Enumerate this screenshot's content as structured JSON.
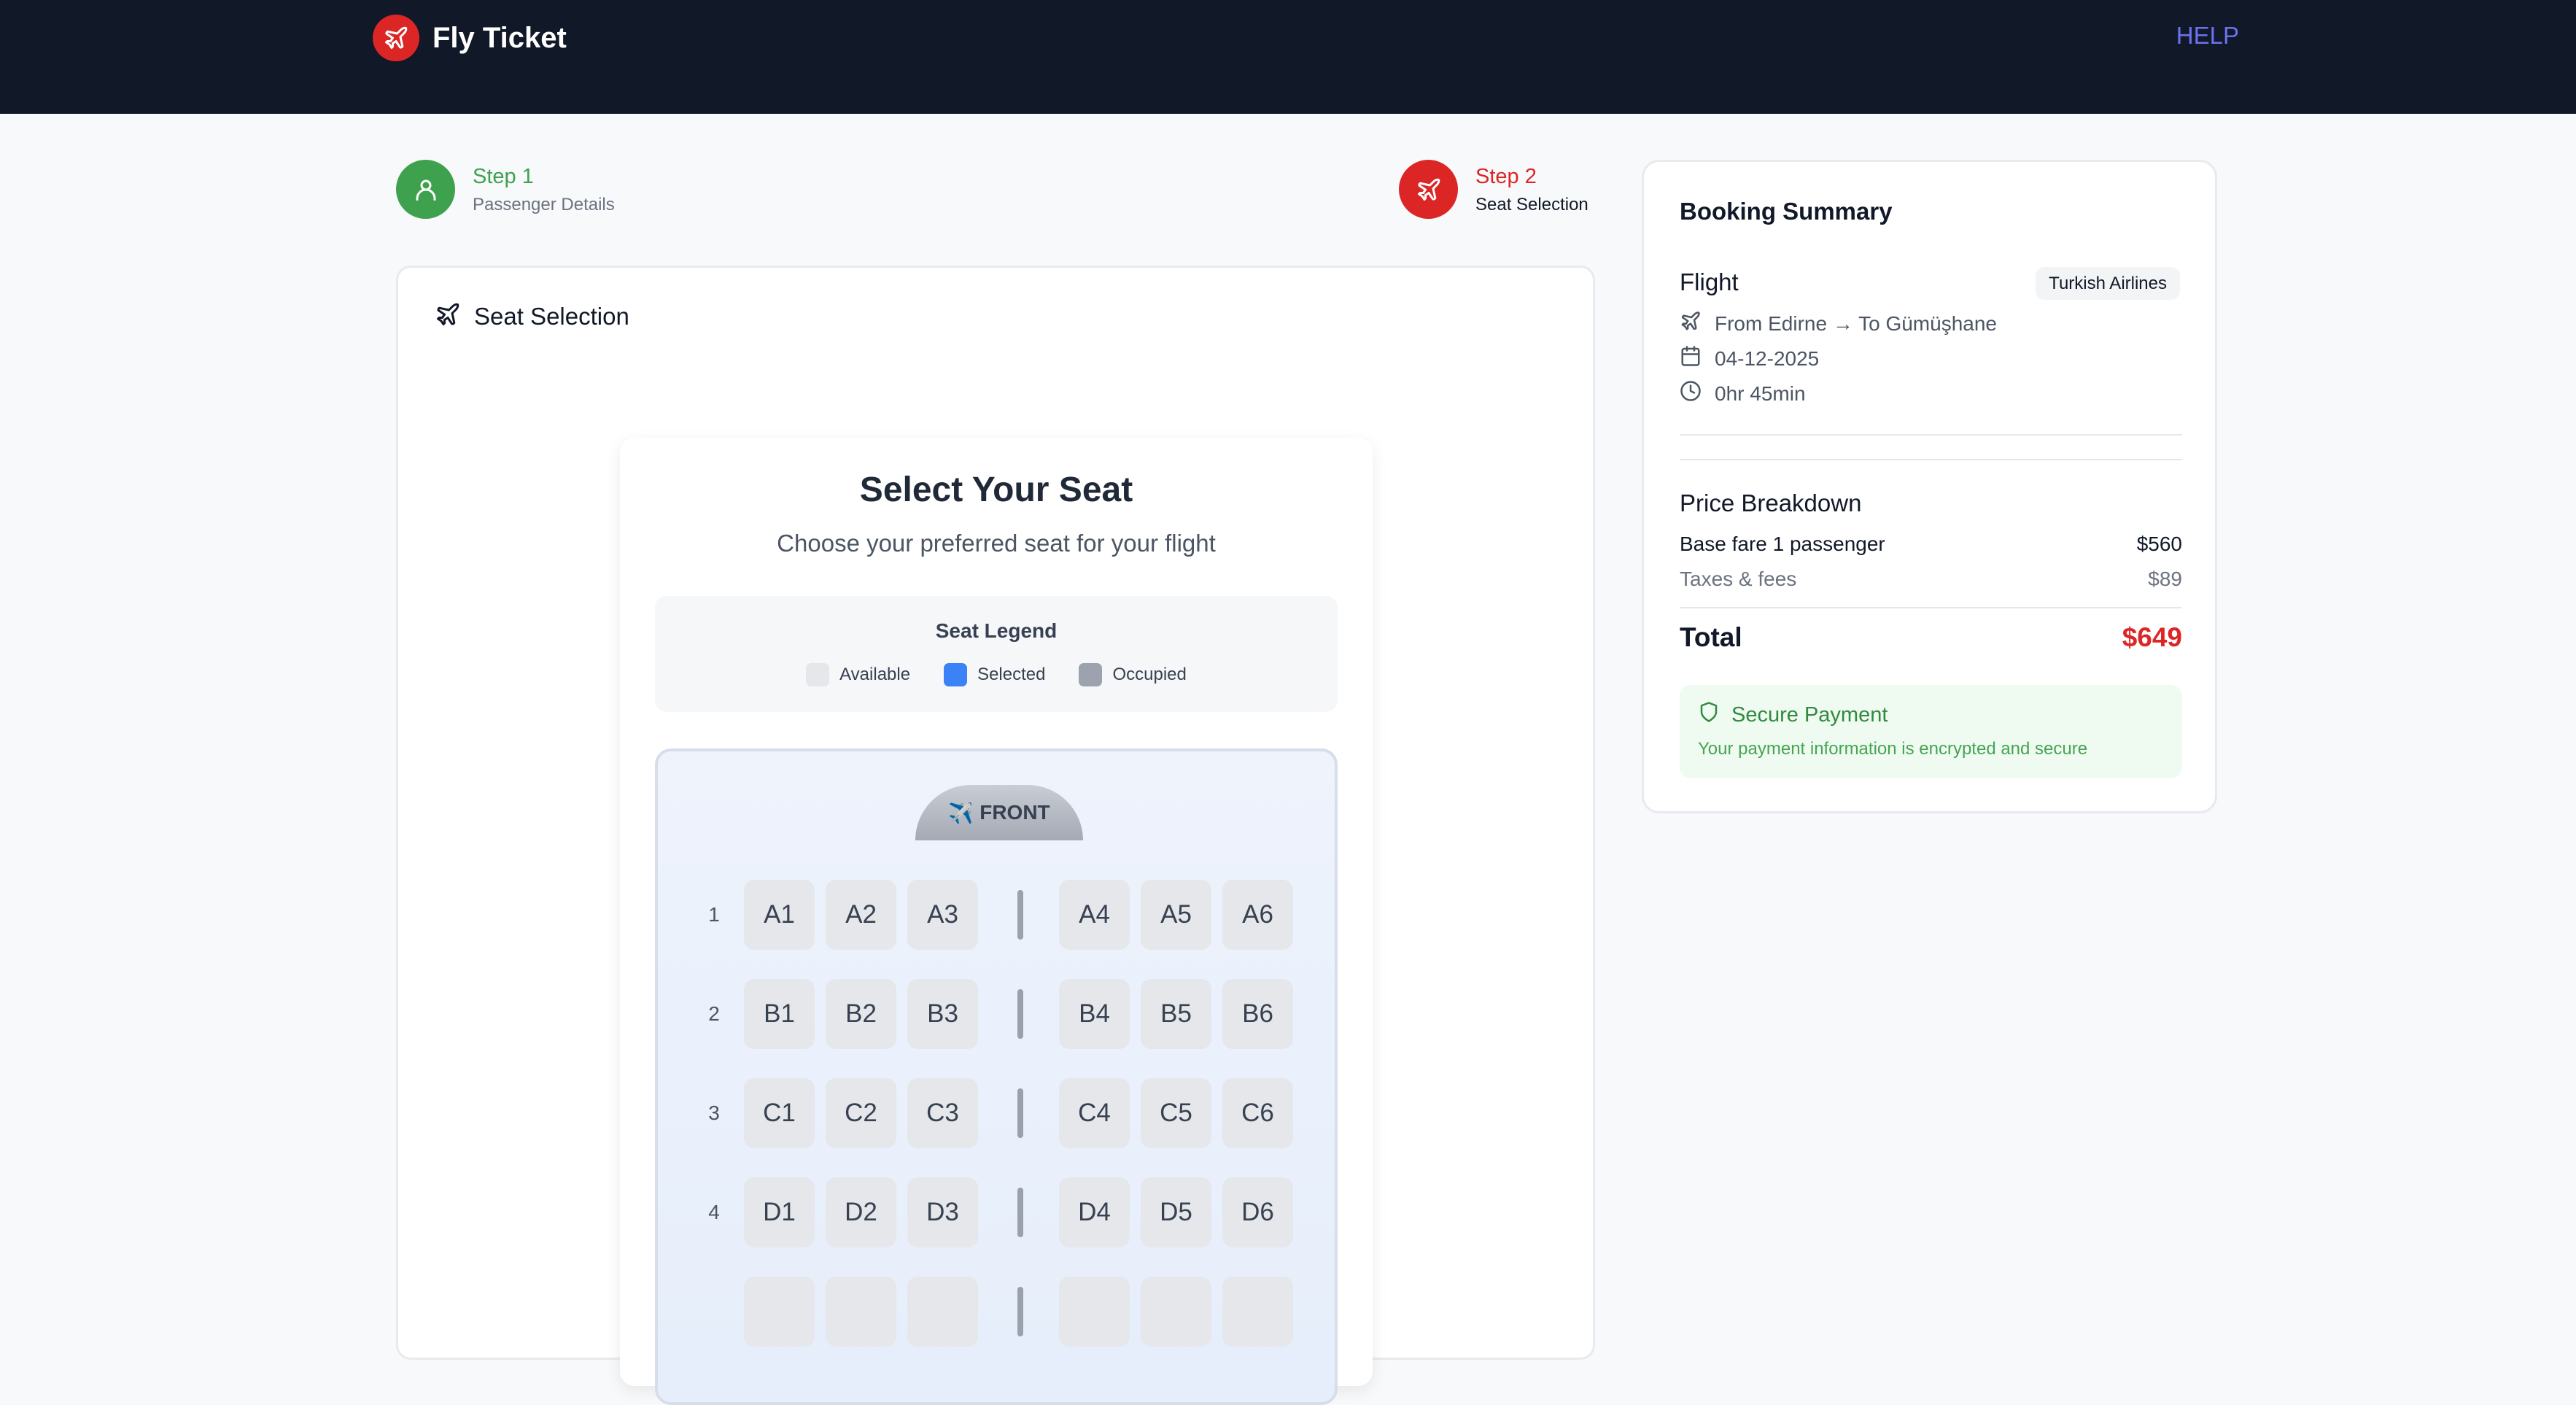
{
  "header": {
    "brand": "Fly Ticket",
    "help": "HELP"
  },
  "steps": [
    {
      "title": "Step 1",
      "subtitle": "Passenger Details"
    },
    {
      "title": "Step 2",
      "subtitle": "Seat Selection"
    }
  ],
  "main": {
    "card_title": "Seat Selection",
    "panel_title": "Select Your Seat",
    "panel_subtitle": "Choose your preferred seat for your flight",
    "legend": {
      "title": "Seat Legend",
      "items": [
        {
          "label": "Available",
          "color": "#e5e7eb"
        },
        {
          "label": "Selected",
          "color": "#3b82f6"
        },
        {
          "label": "Occupied",
          "color": "#9ca3af"
        }
      ]
    },
    "front_label": "FRONT",
    "rows": [
      {
        "number": "1",
        "seats": [
          "A1",
          "A2",
          "A3",
          "A4",
          "A5",
          "A6"
        ]
      },
      {
        "number": "2",
        "seats": [
          "B1",
          "B2",
          "B3",
          "B4",
          "B5",
          "B6"
        ]
      },
      {
        "number": "3",
        "seats": [
          "C1",
          "C2",
          "C3",
          "C4",
          "C5",
          "C6"
        ]
      },
      {
        "number": "4",
        "seats": [
          "D1",
          "D2",
          "D3",
          "D4",
          "D5",
          "D6"
        ]
      }
    ]
  },
  "summary": {
    "title": "Booking Summary",
    "flight_label": "Flight",
    "airline": "Turkish Airlines",
    "route": "From Edirne → To Gümüşhane",
    "date": "04-12-2025",
    "duration": "0hr 45min",
    "price_breakdown_title": "Price Breakdown",
    "base_fare_label": "Base fare 1 passenger",
    "base_fare_value": "$560",
    "taxes_label": "Taxes & fees",
    "taxes_value": "$89",
    "total_label": "Total",
    "total_value": "$649",
    "secure_title": "Secure Payment",
    "secure_text": "Your payment information is encrypted and secure"
  },
  "colors": {
    "accent_red": "#dc2626",
    "success_green": "#3da14d",
    "nav_bg": "#111827",
    "help_link": "#6b72f0"
  },
  "icons": [
    "plane-icon",
    "user-icon",
    "calendar-icon",
    "clock-icon",
    "shield-icon"
  ]
}
